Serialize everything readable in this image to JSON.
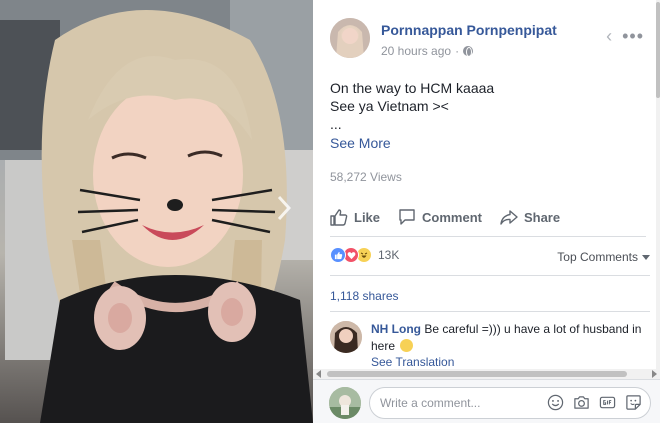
{
  "photo": {
    "alt": "",
    "next_icon": "chevron-right-icon"
  },
  "header": {
    "author": "Pornnappan Pornpenpipat",
    "timestamp": "20 hours ago",
    "separator": "·",
    "privacy_icon": "globe-icon",
    "back_icon": "chevron-left-icon",
    "more_icon": "more-dots-icon",
    "back_glyph": "‹",
    "more_glyph": "•••"
  },
  "post": {
    "lines": [
      "On the way to HCM kaaaa",
      "See ya Vietnam ><",
      "..."
    ],
    "see_more": "See More"
  },
  "views": "58,272 Views",
  "actions": {
    "like": "Like",
    "comment": "Comment",
    "share": "Share"
  },
  "reactions": {
    "count": "13K",
    "types": [
      "like",
      "love",
      "haha"
    ]
  },
  "top_comments": "Top Comments",
  "shares": "1,118 shares",
  "comment": {
    "author": "NH Long",
    "text": "Be careful =))) u have a lot of husband in here",
    "see_translation": "See Translation"
  },
  "composer": {
    "placeholder": "Write a comment..."
  },
  "colors": {
    "link": "#365899",
    "meta": "#90949c",
    "like_reaction": "#5890ff",
    "love_reaction": "#f25268",
    "haha_reaction": "#f7d156"
  }
}
